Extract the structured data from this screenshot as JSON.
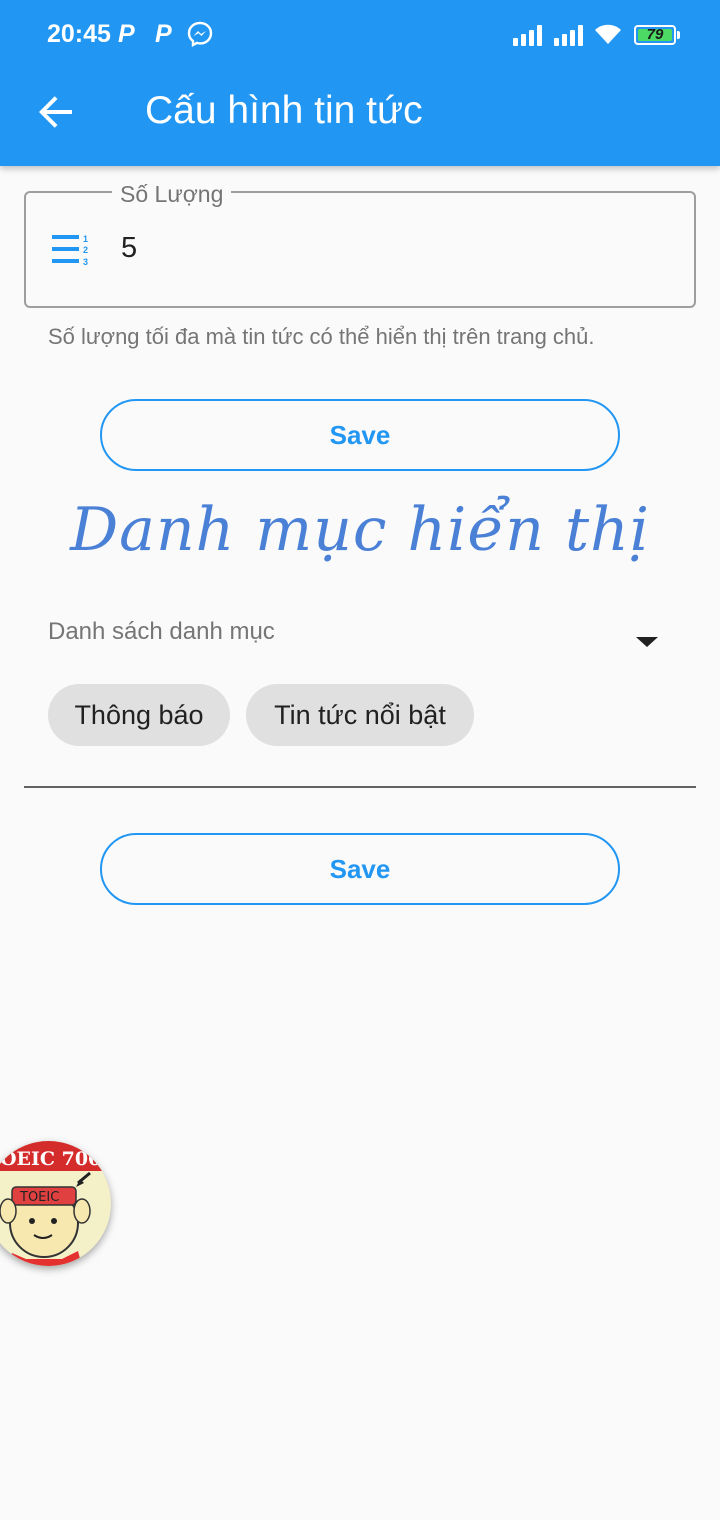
{
  "status_bar": {
    "time": "20:45",
    "notif_1": "P",
    "notif_2": "P",
    "battery": "79"
  },
  "app_bar": {
    "title": "Cấu hình tin tức",
    "back_icon": "arrow-left-icon"
  },
  "quantity": {
    "label": "Số Lượng",
    "value": "5",
    "icon": "numbered-list-icon",
    "helper": "Số lượng tối đa mà tin tức có thể hiển thị trên trang chủ."
  },
  "save_top": {
    "label": "Save"
  },
  "section": {
    "title": "Danh mục hiển thị"
  },
  "categories": {
    "label": "Danh sách danh mục",
    "chips": [
      "Thông báo",
      "Tin tức nổi bật"
    ]
  },
  "save_bottom": {
    "label": "Save"
  },
  "bubble": {
    "top_text": "OEIC 700",
    "badge": "TOEIC"
  },
  "colors": {
    "primary": "#2196f3",
    "section_title": "#4a80d6",
    "chip_bg": "#e0e0e0"
  }
}
